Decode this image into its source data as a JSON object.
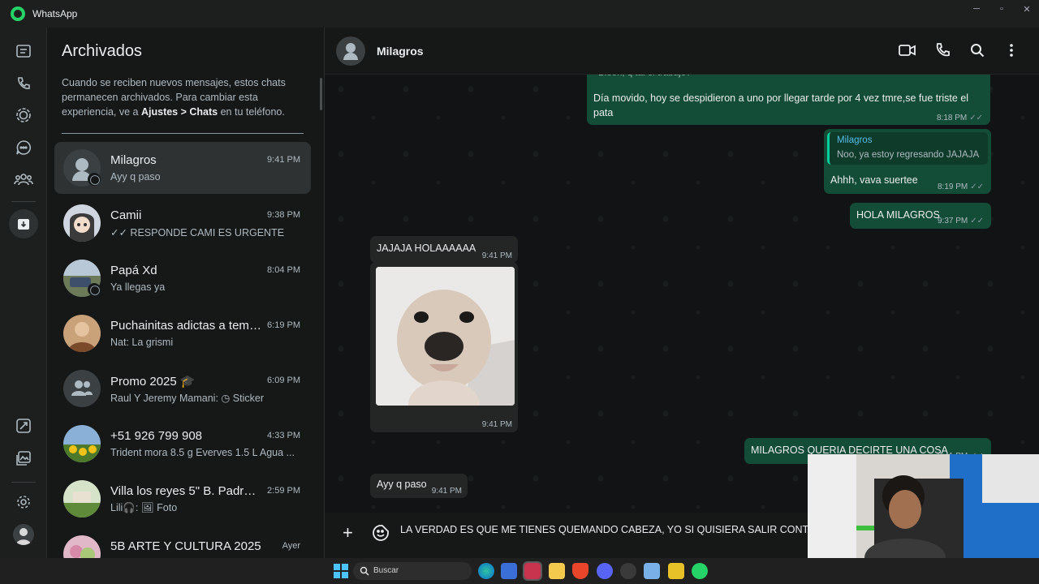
{
  "window": {
    "title": "WhatsApp",
    "minimize": "─",
    "maximize": "▫",
    "close": "✕"
  },
  "rail": {
    "icons": [
      "chats-icon",
      "calls-icon",
      "status-icon",
      "channels-icon",
      "communities-icon",
      "archived-icon",
      "starred-icon",
      "media-icon",
      "settings-icon",
      "profile-avatar"
    ]
  },
  "archived": {
    "title": "Archivados",
    "info_prefix": "Cuando se reciben nuevos mensajes, estos chats permanecen archivados. Para cambiar esta experiencia, ve a ",
    "info_bold": "Ajustes > Chats",
    "info_suffix": " en tu teléfono.",
    "chats": [
      {
        "name": "Milagros",
        "time": "9:41 PM",
        "preview": "Ayy q paso"
      },
      {
        "name": "Camii",
        "time": "9:38 PM",
        "preview": "✓✓ RESPONDE CAMI ES URGENTE"
      },
      {
        "name": "Papá Xd",
        "time": "8:04 PM",
        "preview": "Ya llegas ya"
      },
      {
        "name": "Puchainitas adictas a temu ...",
        "time": "6:19 PM",
        "preview": "Nat: La grismi"
      },
      {
        "name": "Promo 2025 🎓",
        "time": "6:09 PM",
        "preview": "Raul Y Jeremy Mamani: ◷ Sticker"
      },
      {
        "name": "+51 926 799 908",
        "time": "4:33 PM",
        "preview": "Trident mora 8.5 g  Everves 1.5 L Agua ..."
      },
      {
        "name": "Villa los reyes 5\" B. Padres ...",
        "time": "2:59 PM",
        "preview": "Lili🎧: 🖼 Foto"
      },
      {
        "name": "5B ARTE Y CULTURA 2025",
        "time": "Ayer",
        "preview": ""
      }
    ]
  },
  "chat": {
    "contact": "Milagros",
    "messages": {
      "m0_text": "Bieen, q tal el trabajo?",
      "m1_text": "Día movido, hoy se despidieron a uno por llegar tarde por 4 vez tmre,se fue triste el pata",
      "m1_time": "8:18 PM",
      "m2_quote_name": "Milagros",
      "m2_quote_text": "Noo, ya estoy regresando JAJAJA",
      "m2_text": "Ahhh, vava suertee",
      "m2_time": "8:19 PM",
      "m3_text": "HOLA MILAGROS",
      "m3_time": "9:37 PM",
      "m4_text": "JAJAJA HOLAAAAAA",
      "m4_time": "9:41 PM",
      "m5_time": "9:41 PM",
      "m6_text": "MILAGROS QUERIA DECIRTE UNA COSA",
      "m6_time": "9:41 PM",
      "m7_text": "Ayy q paso",
      "m7_time": "9:41 PM"
    },
    "composer_text": "LA VERDAD ES QUE ME TIENES QUEMANDO CABEZA, YO SI QUISIERA SALIR CONTI"
  },
  "taskbar": {
    "search_placeholder": "Buscar"
  },
  "colors": {
    "accent": "#25d366",
    "outgoing_bubble": "#144d37",
    "incoming_bubble": "#242626",
    "background": "#161717"
  }
}
